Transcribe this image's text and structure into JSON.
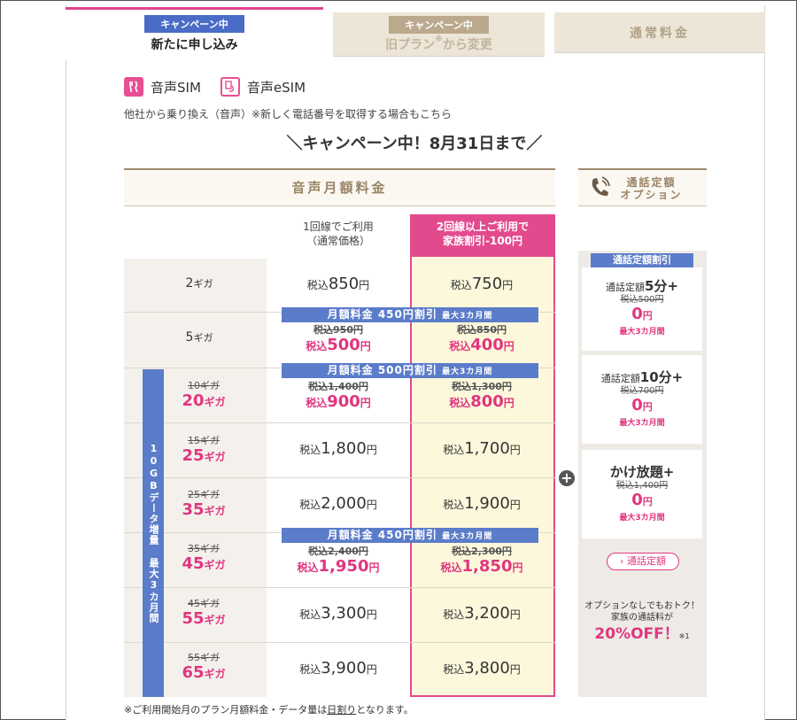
{
  "tabs": {
    "new": {
      "badge": "キャンペーン中",
      "title": "新たに申し込み"
    },
    "old": {
      "badge": "キャンペーン中",
      "title_prefix": "旧プラン",
      "title_sup": "※",
      "title_suffix": "から変更"
    },
    "normal": {
      "title": "通常料金"
    }
  },
  "sim": {
    "voice_sim": "音声SIM",
    "voice_esim": "音声eSIM",
    "note": "他社から乗り換え（音声）※新しく電話番号を取得する場合もこちら"
  },
  "campaign_title": "＼キャンペーン中！8月31日まで／",
  "table": {
    "header": "音声月額料金",
    "col1_line1": "1回線でご利用",
    "col1_line2": "（通常価格）",
    "col2_line1": "2回線以上ご利用で",
    "col2_line2": "家族割引-100円",
    "tax_label": "税込",
    "yen": "円",
    "giga": "ギガ",
    "side_tag": "10GBデータ増量 最大3カ月間",
    "rows": [
      {
        "gb_old": "",
        "gb": "2",
        "p1_old": "",
        "p1": "850",
        "p2_old": "",
        "p2": "750"
      },
      {
        "gb_old": "",
        "gb": "5",
        "p1_old": "税込950円",
        "p1": "500",
        "p2_old": "税込850円",
        "p2": "400"
      },
      {
        "gb_old": "10ギガ",
        "gb": "20",
        "p1_old": "税込1,400円",
        "p1": "900",
        "p2_old": "税込1,300円",
        "p2": "800"
      },
      {
        "gb_old": "15ギガ",
        "gb": "25",
        "p1_old": "",
        "p1": "1,800",
        "p2_old": "",
        "p2": "1,700"
      },
      {
        "gb_old": "25ギガ",
        "gb": "35",
        "p1_old": "",
        "p1": "2,000",
        "p2_old": "",
        "p2": "1,900"
      },
      {
        "gb_old": "35ギガ",
        "gb": "45",
        "p1_old": "税込2,400円",
        "p1": "1,950",
        "p2_old": "税込2,300円",
        "p2": "1,850"
      },
      {
        "gb_old": "45ギガ",
        "gb": "55",
        "p1_old": "",
        "p1": "3,300",
        "p2_old": "",
        "p2": "3,200"
      },
      {
        "gb_old": "55ギガ",
        "gb": "65",
        "p1_old": "",
        "p1": "3,900",
        "p2_old": "",
        "p2": "3,800"
      }
    ],
    "banners": [
      {
        "main": "月額料金 450円割引",
        "small": "最大3カ月間"
      },
      {
        "main": "月額料金 500円割引",
        "small": "最大3カ月間"
      },
      {
        "main": "月額料金 450円割引",
        "small": "最大3カ月間"
      }
    ],
    "footnote_prefix": "※ご利用開始月のプラン月額料金・データ量は",
    "footnote_link": "日割り",
    "footnote_suffix": "となります。"
  },
  "options": {
    "header_line1": "通話定額",
    "header_line2": "オプション",
    "discount_tag": "通話定額割引",
    "cards": [
      {
        "name_pre": "通話定額",
        "name_big": "5分+",
        "old": "税込500円",
        "price": "0",
        "yen": "円",
        "limit": "最大3カ月間"
      },
      {
        "name_pre": "通話定額",
        "name_big": "10分+",
        "old": "税込700円",
        "price": "0",
        "yen": "円",
        "limit": "最大3カ月間"
      },
      {
        "name_pre": "",
        "name_big": "かけ放題+",
        "old": "税込1,400円",
        "price": "0",
        "yen": "円",
        "limit": "最大3カ月間"
      }
    ],
    "link_label": "通話定額",
    "promo_line1": "オプションなしでもおトク！",
    "promo_line2": "家族の通話料が",
    "promo_big": "20%OFF！",
    "promo_note": "※1"
  },
  "colors": {
    "accent_pink": "#e34a8e",
    "accent_blue": "#5b7cc9",
    "beige": "#ede5d8"
  }
}
